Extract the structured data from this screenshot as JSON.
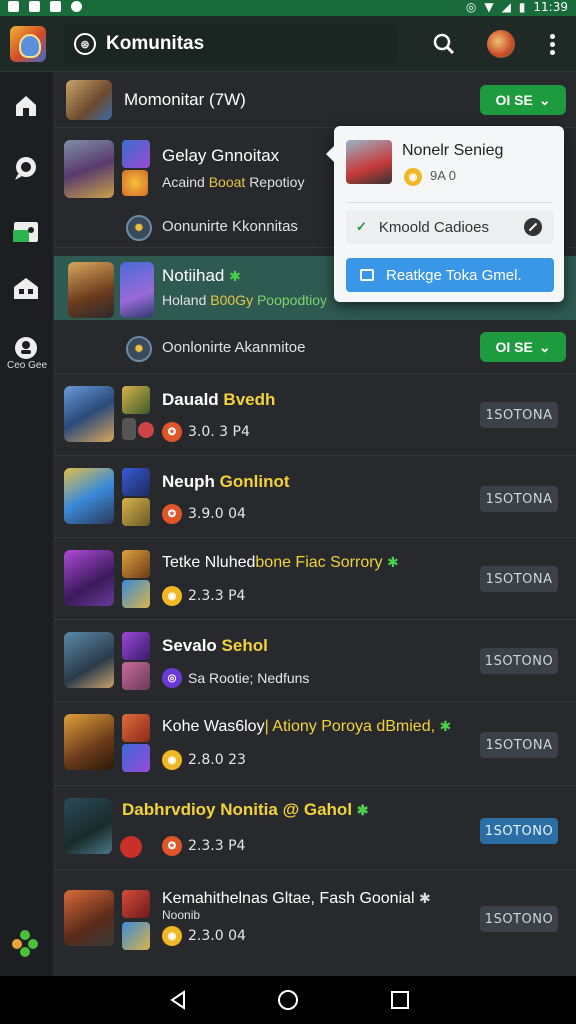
{
  "status_bar": {
    "time": "11:39"
  },
  "appbar": {
    "title": "Komunitas"
  },
  "sidebar": {
    "label": "Ceo Gee"
  },
  "header_row": {
    "title": "Momonitar (7W)",
    "button": "OI SE"
  },
  "group1": {
    "title": "Gelay Gnnoitax",
    "sub_prefix": "Acaind",
    "sub_highlight": "Booat",
    "sub_suffix": "Repotioy",
    "community": "Oonunirte Kkonnitas"
  },
  "group2": {
    "title": "Notiihad",
    "sub_prefix": "Holand",
    "sub_highlight": "B00Gy",
    "sub_suffix": "Poopodtioy",
    "community": "Oonlonirte Akanmitoe",
    "button": "OI SE"
  },
  "items": [
    {
      "title_a": "Dauald",
      "title_b": "Bvedh",
      "meta": "3.0. 3 P4",
      "tag": "1SOTONA"
    },
    {
      "title_a": "Neuph",
      "title_b": "Gonlinot",
      "meta": "3.9.0 04",
      "tag": "1SOTONA"
    },
    {
      "title_a": "Tetke Nluhed",
      "title_b": "bone Fiac Sorrory",
      "meta": "2.3.3 P4",
      "tag": "1SOTONA"
    },
    {
      "title_a": "Sevalo",
      "title_b": "Sehol",
      "meta": "Sa Rootie; Nedfuns",
      "tag": "1SOTONO"
    },
    {
      "title_a": "Kohe Was6loy",
      "title_b": "| Ationy Poroya dBmied,",
      "meta": "2.8.0 23",
      "tag": "1SOTONA"
    },
    {
      "title_a": "",
      "title_b": "Dabhrvdioy Nonitia @ Gahol",
      "meta": "2.3.3 P4",
      "tag": "1SOTONO"
    },
    {
      "title_a": "Kemahithelnas Gltae, Fash Goonial",
      "title_b": "",
      "sub": "Noonib",
      "meta": "2.3.0 04",
      "tag": "1SOTONO"
    }
  ],
  "popup": {
    "name": "Nonelr Senieg",
    "meta": "9A 0",
    "option": "Kmoold Cadioes",
    "cta": "Reatkge Toka Gmel."
  }
}
